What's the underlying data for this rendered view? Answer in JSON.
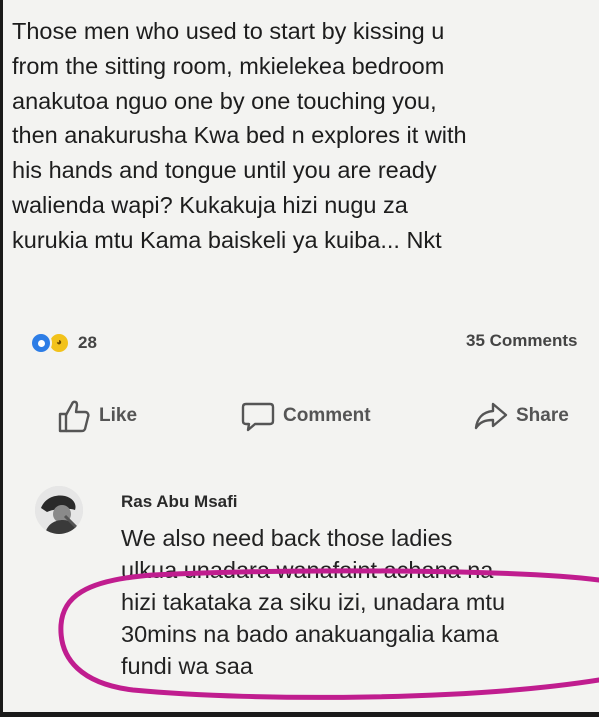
{
  "post": {
    "lines": [
      "Those men who used to start by kissing u",
      "from the sitting room,  mkielekea bedroom",
      "anakutoa nguo one by one touching you,",
      "then anakurusha Kwa bed n explores it with",
      "his hands and tongue until you are ready",
      "walienda wapi?  Kukakuja hizi nugu za",
      "kurukia mtu Kama baiskeli ya kuiba... Nkt"
    ]
  },
  "reactions": {
    "icons": [
      "like-icon",
      "haha-icon"
    ],
    "count": "28",
    "comments_label": "35 Comments"
  },
  "actions": {
    "like": "Like",
    "comment": "Comment",
    "share": "Share"
  },
  "comment": {
    "author": "Ras Abu Msafi",
    "lines": [
      "We also need back those ladies",
      "ulkua unadara wanafaint achana na",
      "hizi takataka za siku izi, unadara mtu",
      "30mins na bado anakuangalia kama",
      "fundi wa saa"
    ]
  },
  "colors": {
    "background": "#f3f3f1",
    "text": "#1d1d1d",
    "like_reaction": "#2d7de6",
    "haha_reaction": "#f2c21b",
    "highlight_circle": "#c01d8f"
  }
}
